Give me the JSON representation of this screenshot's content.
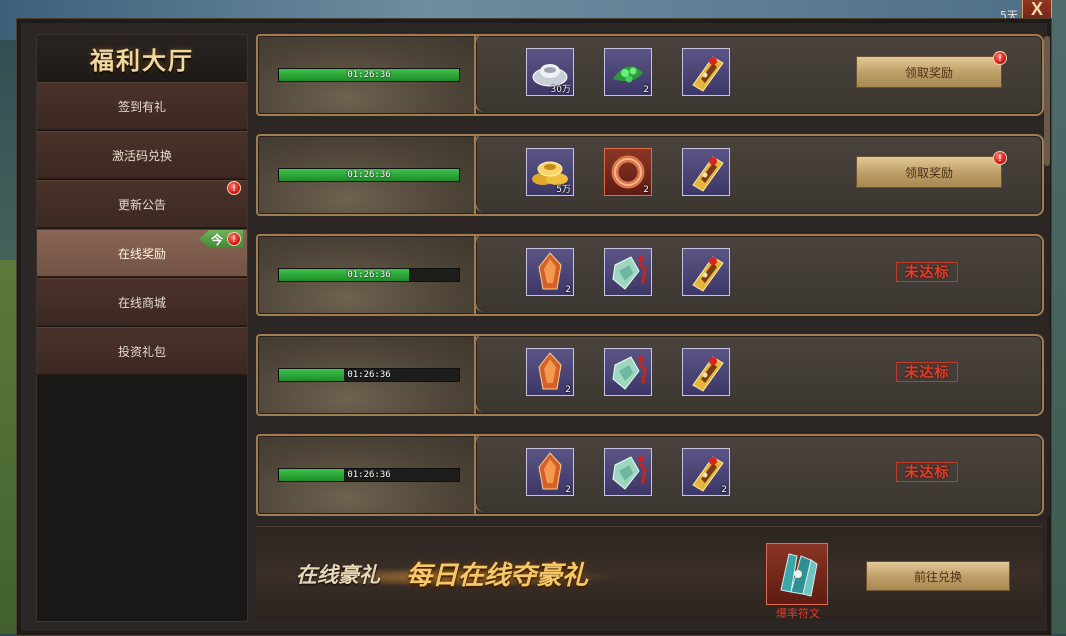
{
  "corner": {
    "server_text": "",
    "days": "5天",
    "close_label": "X"
  },
  "sidebar": {
    "title": "福利大厅",
    "items": [
      {
        "label": "签到有礼",
        "alert": false,
        "active": false
      },
      {
        "label": "激活码兑换",
        "alert": false,
        "active": false
      },
      {
        "label": "更新公告",
        "alert": true,
        "active": false
      },
      {
        "label": "在线奖励",
        "alert": true,
        "active": true,
        "tag": "今"
      },
      {
        "label": "在线商城",
        "alert": false,
        "active": false
      },
      {
        "label": "投资礼包",
        "alert": false,
        "active": false
      }
    ],
    "alert_mark": "!"
  },
  "rows": [
    {
      "timer": "01:26:36",
      "progress": 1.0,
      "items": [
        {
          "icon": "silver-ingot-icon",
          "count": "30万"
        },
        {
          "icon": "green-herb-icon",
          "count": "2"
        },
        {
          "icon": "golden-amulet-icon",
          "count": ""
        }
      ],
      "status": "claim",
      "button_label": "领取奖励"
    },
    {
      "timer": "01:26:36",
      "progress": 1.0,
      "items": [
        {
          "icon": "gold-ingot-icon",
          "count": "5万"
        },
        {
          "icon": "ring-icon",
          "count": "2"
        },
        {
          "icon": "golden-amulet-icon",
          "count": ""
        }
      ],
      "status": "claim",
      "button_label": "领取奖励"
    },
    {
      "timer": "01:26:36",
      "progress": 0.72,
      "items": [
        {
          "icon": "flame-crystal-icon",
          "count": "2"
        },
        {
          "icon": "jade-pendant-icon",
          "count": ""
        },
        {
          "icon": "golden-amulet-icon",
          "count": ""
        }
      ],
      "status": "not_reached",
      "status_label": "未达标"
    },
    {
      "timer": "01:26:36",
      "progress": 0.36,
      "items": [
        {
          "icon": "flame-crystal-icon",
          "count": "2"
        },
        {
          "icon": "jade-pendant-icon",
          "count": ""
        },
        {
          "icon": "golden-amulet-icon",
          "count": ""
        }
      ],
      "status": "not_reached",
      "status_label": "未达标"
    },
    {
      "timer": "01:26:36",
      "progress": 0.36,
      "items": [
        {
          "icon": "flame-crystal-icon",
          "count": "2"
        },
        {
          "icon": "jade-pendant-icon",
          "count": ""
        },
        {
          "icon": "golden-amulet-icon",
          "count": "2"
        }
      ],
      "status": "not_reached",
      "status_label": "未达标"
    }
  ],
  "banner": {
    "subtitle": "在线豪礼",
    "title": "每日在线夺豪礼",
    "exchange_item_label": "爆率符文",
    "goto_label": "前往兑换"
  },
  "colors": {
    "progress_green": "#2fae3c",
    "alert_red": "#d51c18",
    "not_reached_red": "#e23e2a",
    "gold_button": "#c8aa72"
  }
}
